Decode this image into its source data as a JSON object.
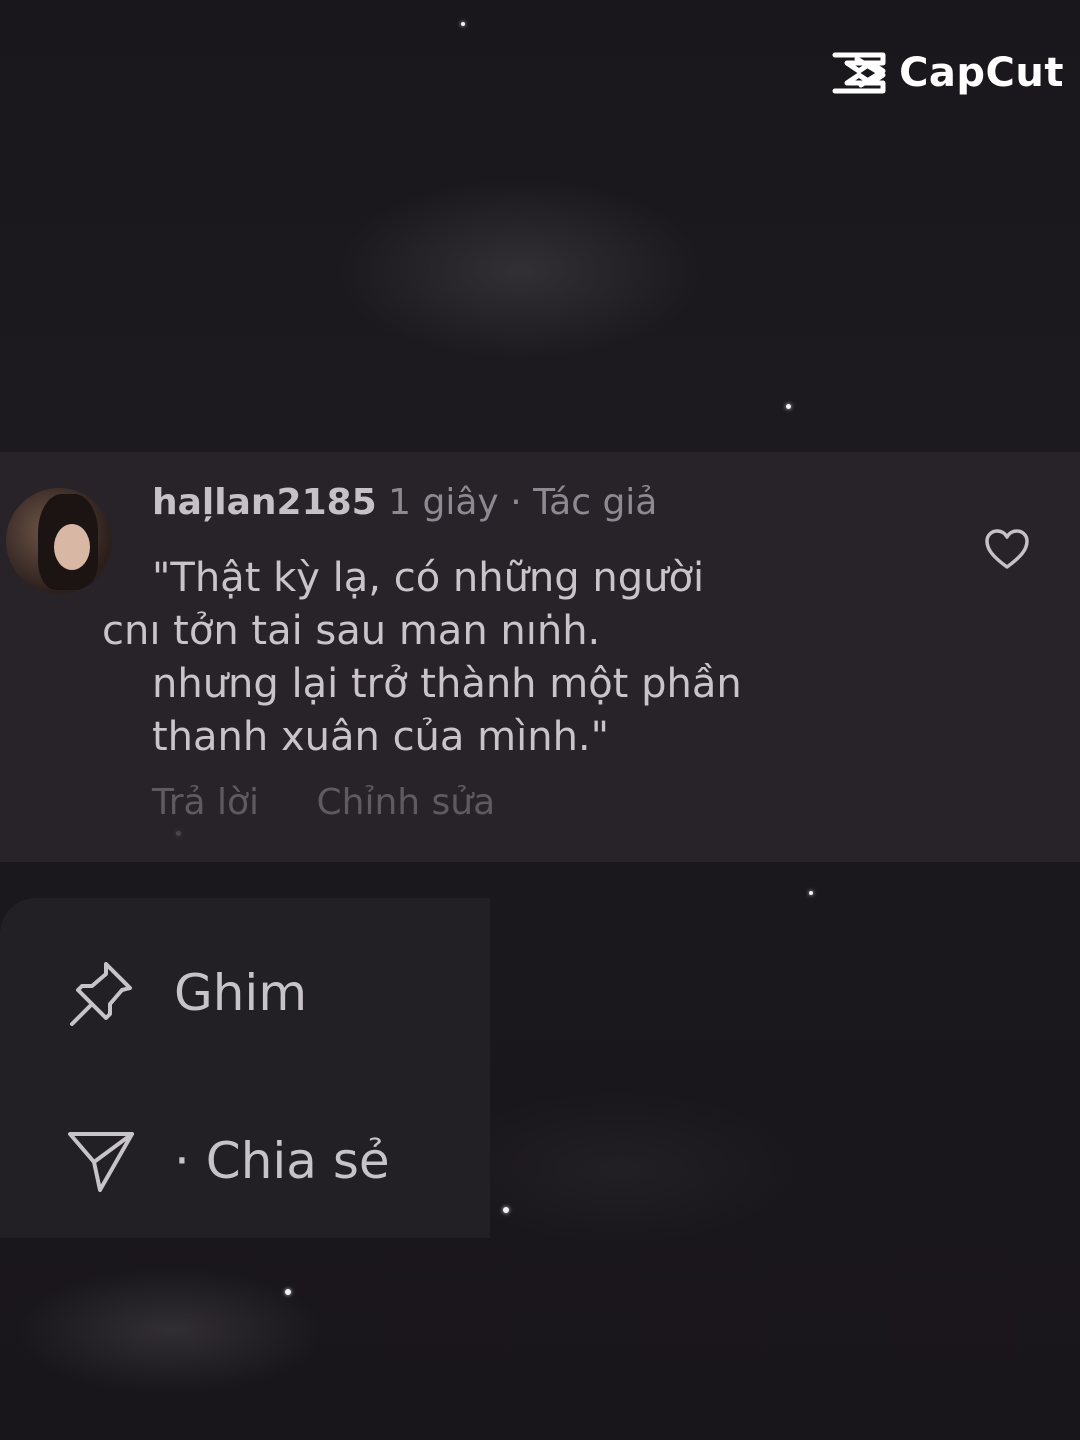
{
  "watermark": {
    "text": "CapCut"
  },
  "comment": {
    "username": "haļlan2185",
    "time": "1 giây",
    "separator": "·",
    "author_badge": "Tác giả",
    "lines": [
      "\"Thật kỳ lạ, có những người",
      "cnı tởn tai sau man nıṅh.",
      "nhưng lại trở thành một phần",
      "thanh xuân của mình.\""
    ],
    "reply_label": "Trả lời",
    "edit_label": "Chỉnh sửa"
  },
  "menu": {
    "pin_label": "Ghim",
    "share_label": "· Chia sẻ"
  },
  "icons": {
    "logo": "capcut-logo-icon",
    "heart": "heart-icon",
    "pin": "pin-icon",
    "share": "send-icon"
  }
}
